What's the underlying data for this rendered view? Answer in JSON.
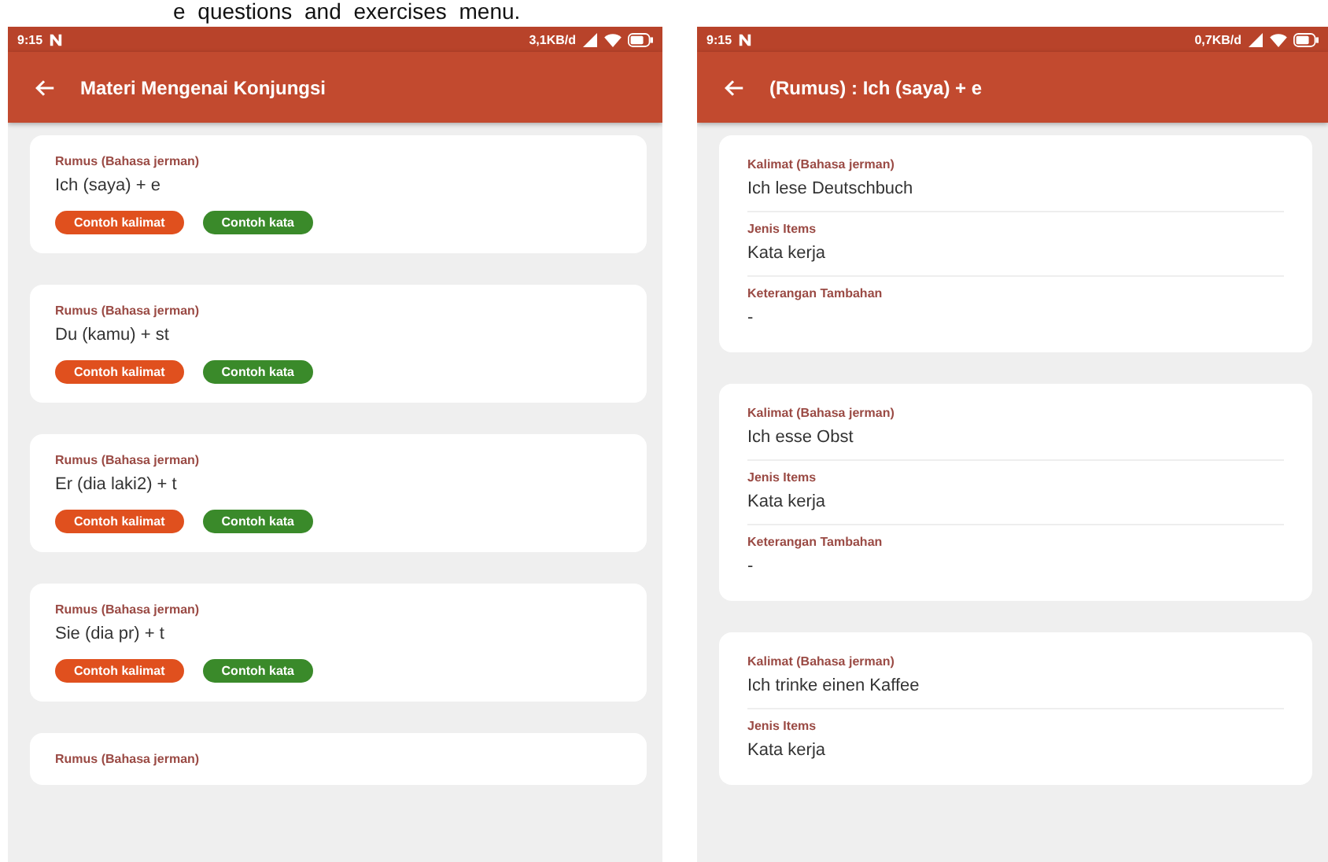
{
  "caption": "e questions and exercises menu.",
  "phones": [
    {
      "status": {
        "time": "9:15",
        "speed": "3,1KB/d"
      },
      "title": "Materi Mengenai Konjungsi",
      "kind": "list",
      "cards": [
        {
          "label": "Rumus (Bahasa jerman)",
          "value": "Ich (saya) + e",
          "buttons": [
            {
              "label": "Contoh kalimat",
              "kind": "sentence"
            },
            {
              "label": "Contoh kata",
              "kind": "word"
            }
          ]
        },
        {
          "label": "Rumus (Bahasa jerman)",
          "value": "Du (kamu) + st",
          "buttons": [
            {
              "label": "Contoh kalimat",
              "kind": "sentence"
            },
            {
              "label": "Contoh kata",
              "kind": "word"
            }
          ]
        },
        {
          "label": "Rumus (Bahasa jerman)",
          "value": "Er (dia laki2) + t",
          "buttons": [
            {
              "label": "Contoh kalimat",
              "kind": "sentence"
            },
            {
              "label": "Contoh kata",
              "kind": "word"
            }
          ]
        },
        {
          "label": "Rumus (Bahasa jerman)",
          "value": "Sie (dia pr) + t",
          "buttons": [
            {
              "label": "Contoh kalimat",
              "kind": "sentence"
            },
            {
              "label": "Contoh kata",
              "kind": "word"
            }
          ]
        },
        {
          "label": "Rumus (Bahasa jerman)"
        }
      ]
    },
    {
      "status": {
        "time": "9:15",
        "speed": "0,7KB/d"
      },
      "title": "(Rumus) : Ich (saya) + e",
      "kind": "detail",
      "cards": [
        {
          "fields": [
            {
              "label": "Kalimat (Bahasa jerman)",
              "value": "Ich lese Deutschbuch"
            },
            {
              "label": "Jenis Items",
              "value": "Kata kerja"
            },
            {
              "label": "Keterangan Tambahan",
              "value": "-"
            }
          ]
        },
        {
          "fields": [
            {
              "label": "Kalimat (Bahasa jerman)",
              "value": "Ich esse Obst"
            },
            {
              "label": "Jenis Items",
              "value": "Kata kerja"
            },
            {
              "label": "Keterangan Tambahan",
              "value": "-"
            }
          ]
        },
        {
          "fields": [
            {
              "label": "Kalimat (Bahasa jerman)",
              "value": "Ich trinke einen Kaffee"
            },
            {
              "label": "Jenis Items",
              "value": "Kata kerja"
            }
          ]
        }
      ]
    }
  ]
}
